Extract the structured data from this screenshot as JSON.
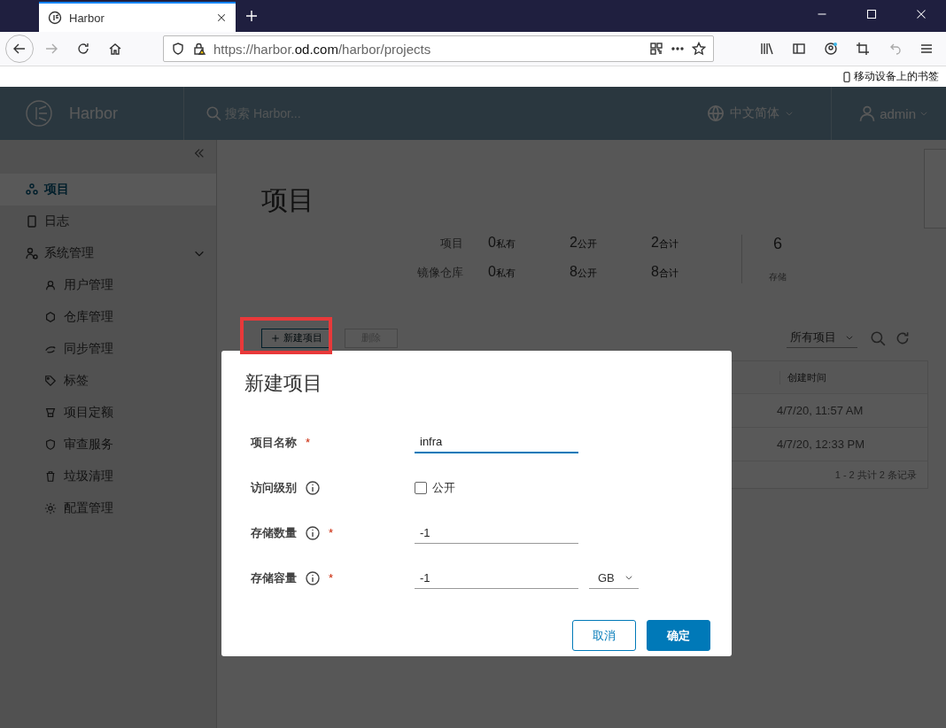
{
  "browser": {
    "tab": {
      "title": "Harbor"
    },
    "url": {
      "prefix": "https://harbor.",
      "domain": "od.com",
      "path": "/harbor/projects"
    },
    "bookmarks": [
      "移动设备上的书签"
    ]
  },
  "header": {
    "brand": "Harbor",
    "search_placeholder": "搜索 Harbor...",
    "language": "中文简体",
    "user": "admin"
  },
  "sidebar": {
    "items": [
      {
        "label": "项目",
        "selected": true
      },
      {
        "label": "日志",
        "selected": false
      },
      {
        "label": "系统管理",
        "selected": false,
        "expanded": true,
        "children": [
          {
            "label": "用户管理",
            "selected": false
          },
          {
            "label": "仓库管理",
            "selected": false
          },
          {
            "label": "同步管理",
            "selected": false
          },
          {
            "label": "标签",
            "selected": false
          },
          {
            "label": "项目定额",
            "selected": false
          },
          {
            "label": "审查服务",
            "selected": false
          },
          {
            "label": "垃圾清理",
            "selected": false
          },
          {
            "label": "配置管理",
            "selected": false
          }
        ]
      }
    ]
  },
  "page": {
    "title": "项目",
    "stats": [
      {
        "label": "项目",
        "cells": [
          {
            "value": "0",
            "unit": "私有"
          },
          {
            "value": "2",
            "unit": "公开"
          },
          {
            "value": "2",
            "unit": "合计"
          }
        ]
      },
      {
        "label": "镜像仓库",
        "cells": [
          {
            "value": "0",
            "unit": "私有"
          },
          {
            "value": "8",
            "unit": "公开"
          },
          {
            "value": "8",
            "unit": "合计"
          }
        ]
      }
    ],
    "storage": {
      "value": "6",
      "label": "存储"
    },
    "toolbar": {
      "new_button": "新建项目",
      "delete_button": {
        "label": "删除",
        "disabled": true
      },
      "filter": "所有项目"
    },
    "table": {
      "columns": [
        {
          "label": "创建时间"
        }
      ],
      "rows": [
        {
          "created": "4/7/20, 11:57 AM"
        },
        {
          "created": "4/7/20, 12:33 PM"
        }
      ],
      "footer": "1 - 2 共计 2 条记录"
    }
  },
  "dialog": {
    "title": "新建项目",
    "fields": [
      {
        "kind": "text",
        "label": "项目名称",
        "info": false,
        "required_mark": "*",
        "value": "infra",
        "focused": true
      },
      {
        "kind": "checkbox",
        "label": "访问级别",
        "info": true,
        "option": "公开",
        "checked": false
      },
      {
        "kind": "text",
        "label": "存储数量",
        "info": true,
        "required_mark": "*",
        "value": "-1",
        "focused": false
      },
      {
        "kind": "unit",
        "label": "存储容量",
        "info": true,
        "required_mark": "*",
        "value": "-1",
        "unit": "GB",
        "focused": false
      }
    ],
    "buttons": [
      {
        "label": "取消",
        "kind": "outline"
      },
      {
        "label": "确定",
        "kind": "primary"
      }
    ]
  }
}
